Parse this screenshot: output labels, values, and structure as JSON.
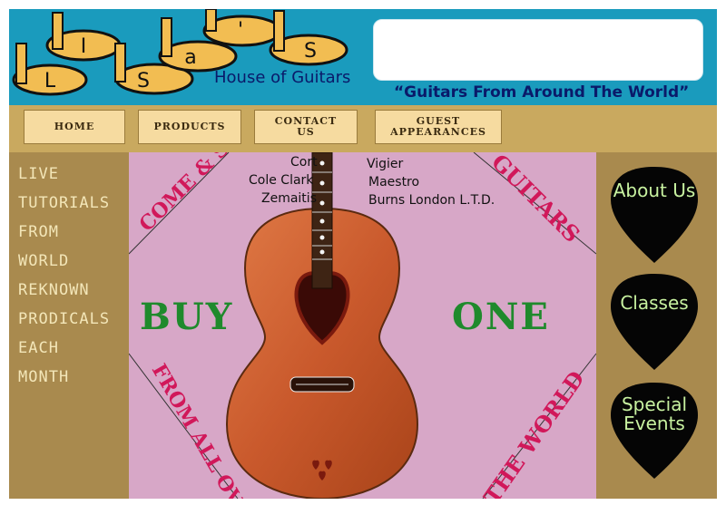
{
  "header": {
    "logo_letters": [
      "L",
      "I",
      "S",
      "a",
      "'",
      "S"
    ],
    "house": "House of Guitars",
    "tagline": "“Guitars From Around The World”"
  },
  "nav": {
    "items": [
      {
        "label": "HOME"
      },
      {
        "label": "PRODUCTS"
      },
      {
        "label": "CONTACT US"
      },
      {
        "label": "GUEST APPEARANCES"
      }
    ]
  },
  "left": {
    "words": [
      "LIVE",
      "TUTORIALS",
      "FROM",
      "WORLD",
      "REKNOWN",
      "PRODICALS",
      "EACH",
      "MONTH"
    ]
  },
  "center": {
    "brands_left": [
      "Cort",
      "Cole Clark",
      "Zemaitis"
    ],
    "brands_right": [
      "Vigier",
      "Maestro",
      "Burns London L.T.D."
    ],
    "buy": "BUY",
    "one": "ONE",
    "tl": "COME & SEE",
    "tr": "GUITARS",
    "bl": "FROM ALL OVER",
    "br": "THE WORLD"
  },
  "right": {
    "picks": [
      {
        "label": "About Us"
      },
      {
        "label": "Classes"
      },
      {
        "label": "Special Events"
      }
    ]
  },
  "colors": {
    "header_bg": "#1a9bbd",
    "nav_bg": "#c9a95f",
    "center_bg": "#d7a7c7",
    "accent_green": "#1f8a2c",
    "accent_pink": "#d1185a"
  }
}
